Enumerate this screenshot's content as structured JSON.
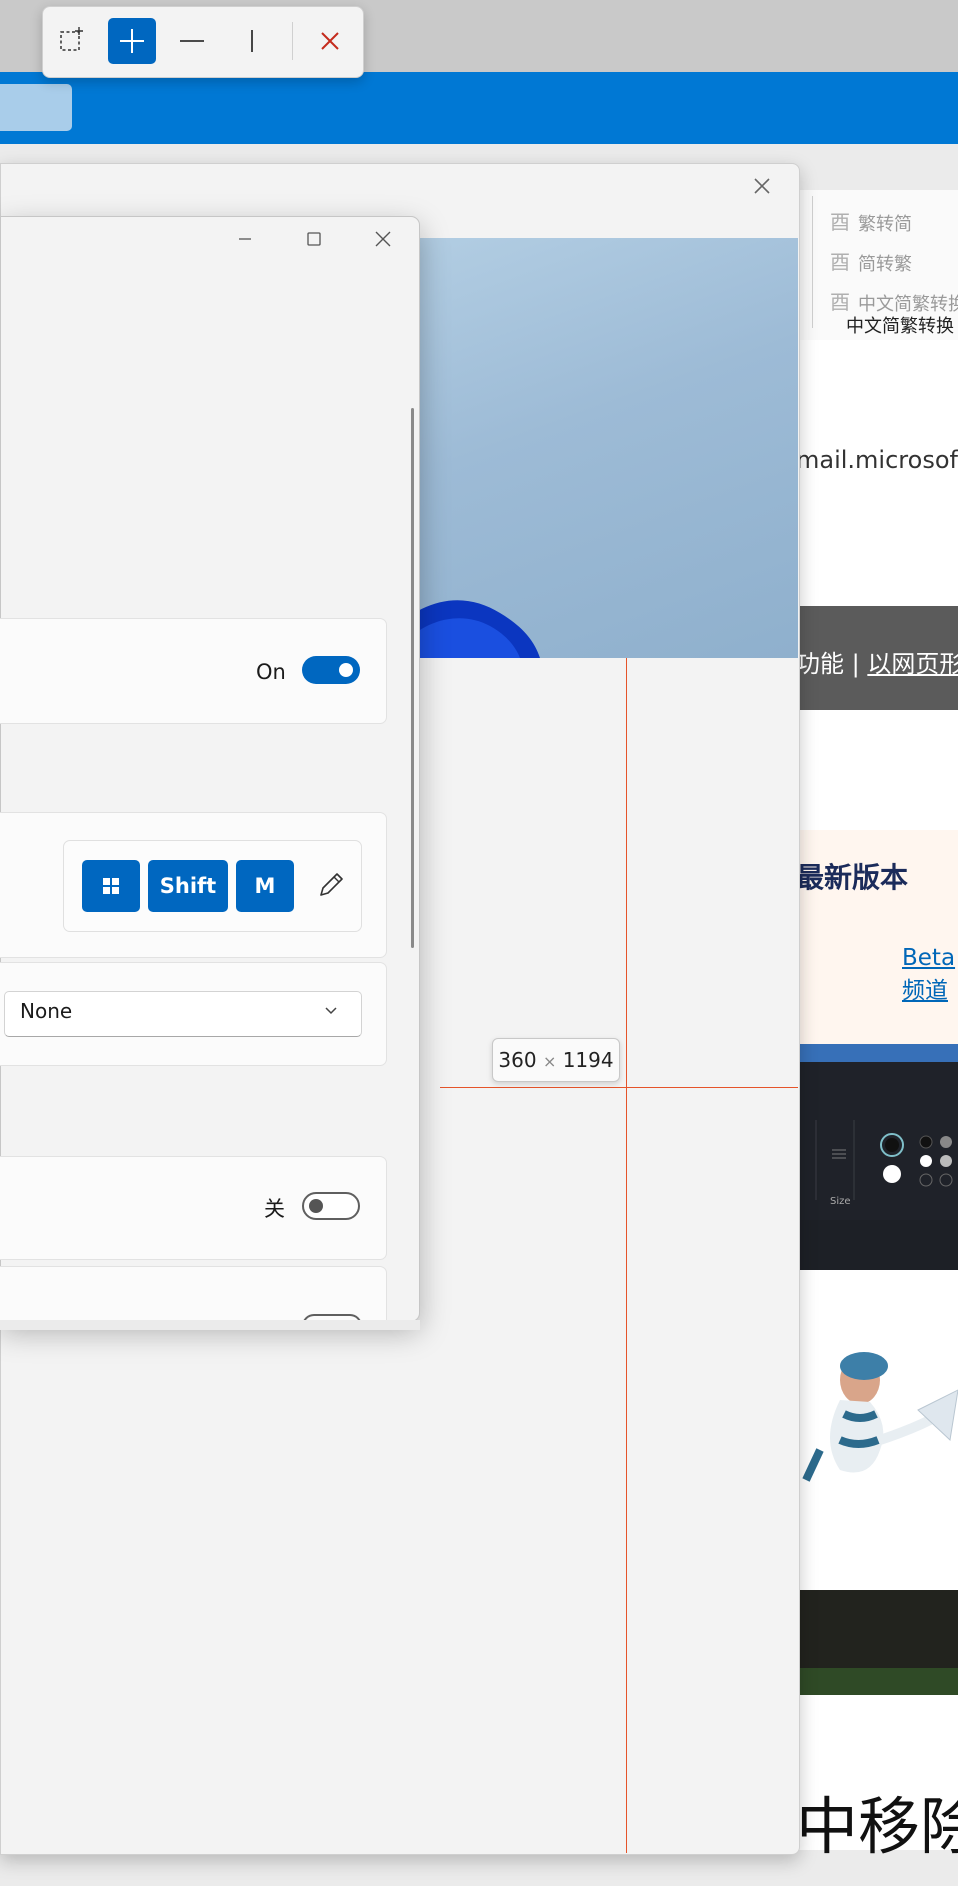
{
  "ribbon": {
    "items": [
      "繁转简",
      "简转繁",
      "中文简繁转换"
    ],
    "group_label": "中文简繁转换"
  },
  "right_page": {
    "email_fragment": "mail.microsoft.co",
    "dark_bar_text": "功能 | ",
    "dark_bar_link": "以网页形式",
    "promo_title": "最新版本",
    "beta_link_line1": "Beta",
    "beta_link_line2": "频道",
    "size_label": "Size",
    "big_text": "中移除"
  },
  "measurement": {
    "width": "360",
    "separator": "×",
    "height": "1194"
  },
  "settings": {
    "toggle_on_label": "On",
    "toggle_on_state": true,
    "shortcut_keys": [
      "Shift",
      "M"
    ],
    "dropdown_value": "None",
    "toggle_off_label": "关",
    "toggle_off_state": false
  },
  "colors": {
    "accent": "#0067c0",
    "titlebar_blue": "#0078d4",
    "measure_line": "#e5542a",
    "close_red": "#c42b1c"
  },
  "icons": {
    "snip_bar": [
      "rectangle-snip-icon",
      "add-icon",
      "horizontal-line-icon",
      "vertical-line-icon",
      "close-icon"
    ],
    "settings_caption": [
      "minimize-icon",
      "maximize-icon",
      "close-icon"
    ],
    "shortcut": [
      "windows-key-icon",
      "pencil-icon"
    ],
    "dropdown": "chevron-down-icon"
  }
}
